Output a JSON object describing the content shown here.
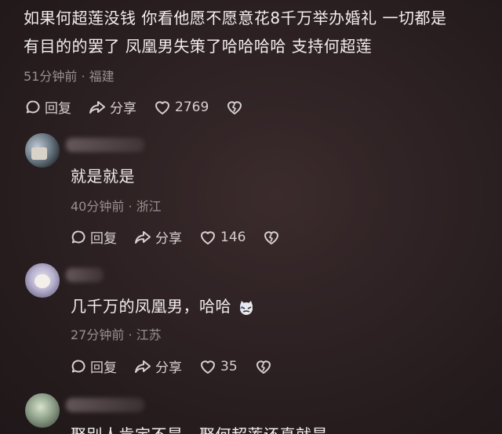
{
  "comments": [
    {
      "text_line1": "如果何超莲没钱 你看他愿不愿意花8千万举办婚礼 一切都是",
      "text_line2": "有目的的罢了 凤凰男失策了哈哈哈哈 支持何超莲",
      "meta": "51分钟前 · 福建",
      "reply_label": "回复",
      "share_label": "分享",
      "likes": "2769"
    },
    {
      "text": "就是就是",
      "meta": "40分钟前 · 浙江",
      "reply_label": "回复",
      "share_label": "分享",
      "likes": "146"
    },
    {
      "text": "几千万的凤凰男，哈哈",
      "meta": "27分钟前 · 江苏",
      "reply_label": "回复",
      "share_label": "分享",
      "likes": "35"
    },
    {
      "text": "娶别人肯定不是，娶何超莲还真就是"
    }
  ],
  "icons": {
    "reply": "comment-bubble-icon",
    "share": "share-arrow-icon",
    "like": "heart-icon",
    "dislike": "broken-heart-icon",
    "emoji": "cat-emoji-icon"
  }
}
